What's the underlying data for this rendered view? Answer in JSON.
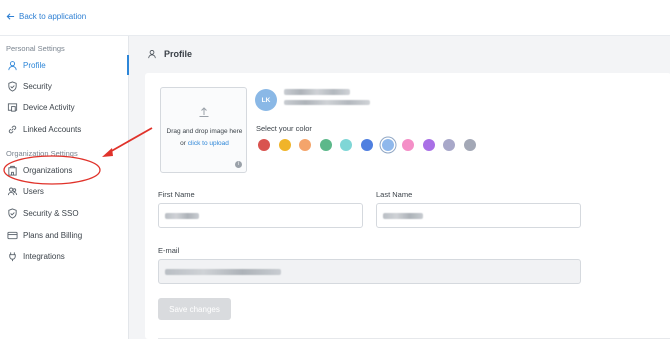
{
  "topbar": {
    "back_label": "Back to application"
  },
  "sidebar": {
    "personal_title": "Personal Settings",
    "org_title": "Organization Settings",
    "personal_items": [
      {
        "label": "Profile",
        "icon": "user-icon",
        "active": true
      },
      {
        "label": "Security",
        "icon": "shield-icon"
      },
      {
        "label": "Device Activity",
        "icon": "laptop-icon"
      },
      {
        "label": "Linked Accounts",
        "icon": "link-icon"
      }
    ],
    "org_items": [
      {
        "label": "Organizations",
        "icon": "building-icon"
      },
      {
        "label": "Users",
        "icon": "users-icon"
      },
      {
        "label": "Security & SSO",
        "icon": "shield-check-icon"
      },
      {
        "label": "Plans and Billing",
        "icon": "credit-card-icon"
      },
      {
        "label": "Integrations",
        "icon": "plug-icon"
      }
    ]
  },
  "main": {
    "title": "Profile",
    "upload": {
      "text": "Drag and drop image here or",
      "link": "click to upload",
      "info": "i"
    },
    "avatar_initials": "LK",
    "color_label": "Select your color",
    "colors": [
      "#d9534f",
      "#f0b429",
      "#f4a46b",
      "#5cb88a",
      "#7fd6d6",
      "#4f7fe0",
      "#8fb8ec",
      "#f48fc7",
      "#a970e6",
      "#a8a8c9",
      "#a3a8b6"
    ],
    "selected_color_index": 6,
    "first_name_label": "First Name",
    "last_name_label": "Last Name",
    "email_label": "E-mail",
    "save_label": "Save changes"
  },
  "annotation": {
    "color": "#e0322a"
  }
}
